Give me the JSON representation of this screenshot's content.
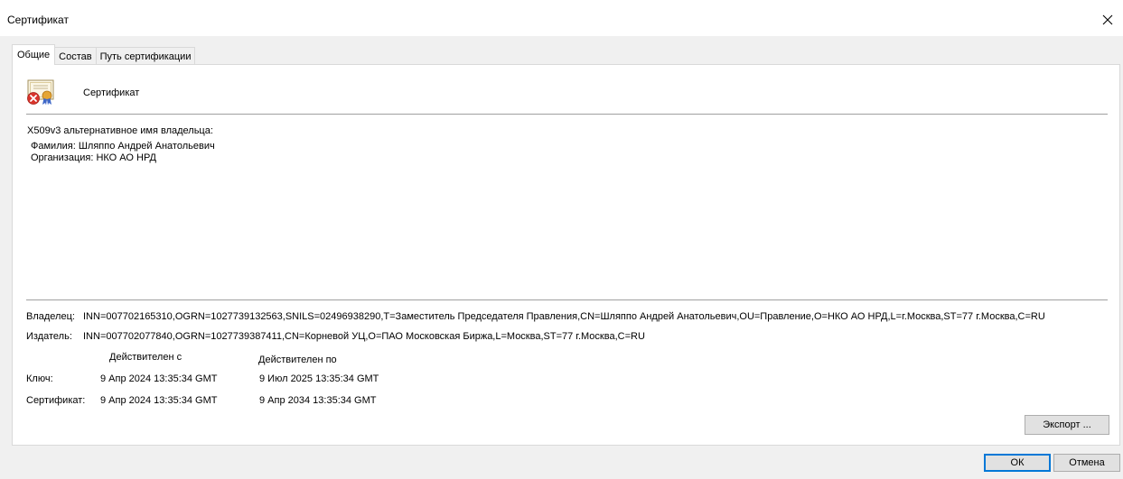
{
  "window": {
    "title": "Сертификат",
    "close_glyph": "✕"
  },
  "tabs": [
    {
      "label": "Общие",
      "active": true
    },
    {
      "label": "Состав",
      "active": false
    },
    {
      "label": "Путь сертификации",
      "active": false
    }
  ],
  "general": {
    "header_label": "Сертификат",
    "icon": "certificate-error-icon",
    "alt_name_title": "X509v3 альтернативное имя владельца:",
    "alt_name_lines": [
      "Фамилия: Шляппо Андрей Анатольевич",
      "Организация: НКО АО НРД"
    ],
    "owner_label": "Владелец:",
    "owner_value": "INN=007702165310,OGRN=1027739132563,SNILS=02496938290,T=Заместитель Председателя Правления,CN=Шляппо Андрей Анатольевич,OU=Правление,O=НКО АО НРД,L=г.Москва,ST=77 г.Москва,C=RU",
    "issuer_label": "Издатель:",
    "issuer_value": "INN=007702077840,OGRN=1027739387411,CN=Корневой УЦ,O=ПАО Московская Биржа,L=Москва,ST=77 г.Москва,C=RU",
    "validity": {
      "col_from": "Действителен с",
      "col_to": "Действителен по",
      "rows": [
        {
          "label": "Ключ:",
          "from": "9 Апр 2024 13:35:34 GMT",
          "to": "9 Июл 2025 13:35:34 GMT"
        },
        {
          "label": "Сертификат:",
          "from": "9 Апр 2024 13:35:34 GMT",
          "to": "9 Апр 2034 13:35:34 GMT"
        }
      ]
    },
    "export_label": "Экспорт ..."
  },
  "footer": {
    "ok_label": "ОК",
    "cancel_label": "Отмена"
  },
  "colors": {
    "accent": "#0078d7",
    "error_red": "#d9342b"
  }
}
